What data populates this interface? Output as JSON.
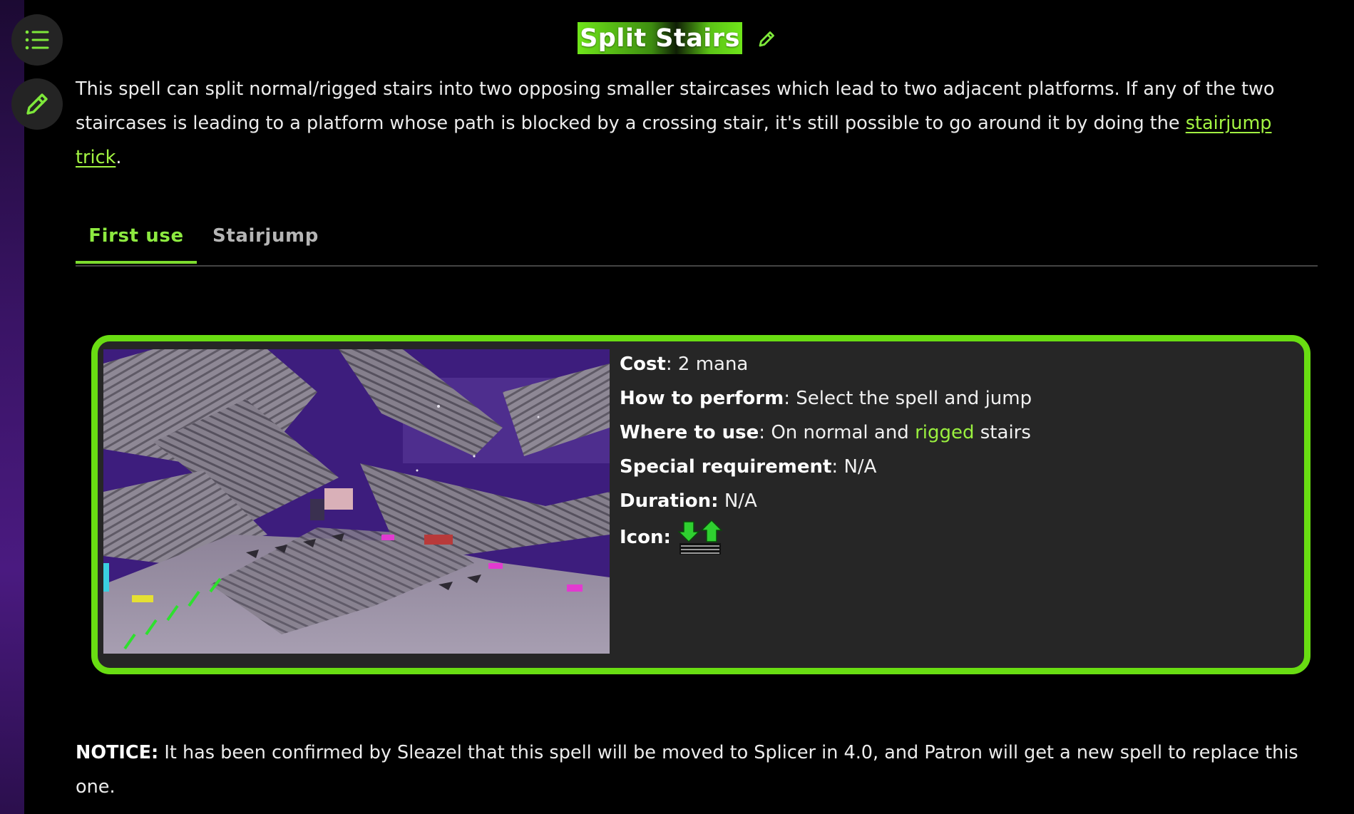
{
  "sidebar": {
    "toc_button": "table-of-contents-icon",
    "edit_button": "pencil-icon"
  },
  "header": {
    "title": "Split Stairs",
    "edit_icon": "pencil-icon",
    "accent_color": "#6fe51a"
  },
  "intro": {
    "text_before_link": "This spell can split normal/rigged stairs into two opposing smaller staircases which lead to two adjacent platforms. If any of the two staircases is leading to a platform whose path is blocked by a crossing stair, it's still possible to go around it by doing the ",
    "link_text": "stairjump trick",
    "text_after_link": "."
  },
  "tabs": [
    {
      "label": "First use",
      "active": true
    },
    {
      "label": "Stairjump",
      "active": false
    }
  ],
  "card": {
    "border_color": "#69dd12",
    "image": "spell-demo-screenshot",
    "cost_label": "Cost",
    "cost_value": ": 2 mana",
    "perform_label": "How to perform",
    "perform_value": ": Select the spell and jump",
    "where_label": "Where to use",
    "where_before": ": On normal and ",
    "where_link": "rigged",
    "where_after": " stairs",
    "requirement_label": "Special requirement",
    "requirement_value": ": N/A",
    "duration_label": "Duration:",
    "duration_value": " N/A",
    "icon_label": "Icon:",
    "icon_name": "split-stairs-icon"
  },
  "notice": {
    "label": "NOTICE:",
    "text": " It has been confirmed by Sleazel that this spell will be moved to Splicer in 4.0, and Patron will get a new spell to replace this one."
  }
}
